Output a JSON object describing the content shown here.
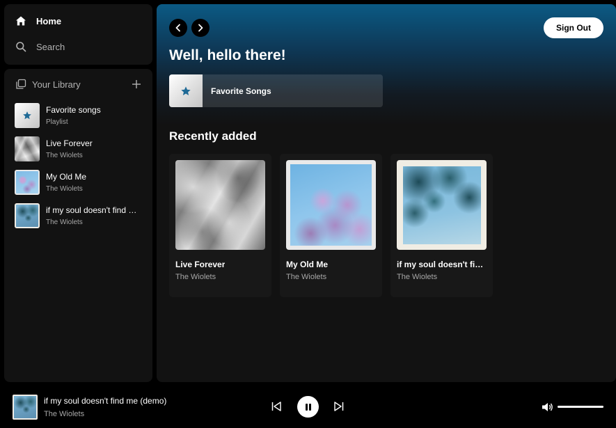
{
  "nav": {
    "home_label": "Home",
    "search_label": "Search"
  },
  "library": {
    "title": "Your Library",
    "items": [
      {
        "title": "Favorite songs",
        "subtitle": "Playlist",
        "thumb": "star-icon"
      },
      {
        "title": "Live Forever",
        "subtitle": "The Wiolets",
        "thumb": "silk-cover"
      },
      {
        "title": "My Old Me",
        "subtitle": "The Wiolets",
        "thumb": "blossom-tree-cover"
      },
      {
        "title": "if my soul doesn't find me (demo)",
        "subtitle": "The Wiolets",
        "thumb": "tree-canopy-cover"
      }
    ]
  },
  "main": {
    "greeting": "Well, hello there!",
    "sign_out_label": "Sign Out",
    "favorite_card_label": "Favorite Songs",
    "recent_heading": "Recently added",
    "recent": [
      {
        "title": "Live Forever",
        "artist": "The Wiolets",
        "art": "silk-cover"
      },
      {
        "title": "My Old Me",
        "artist": "The Wiolets",
        "art": "blossom-tree-cover"
      },
      {
        "title": "if my soul doesn't find me (demo)",
        "artist": "The Wiolets",
        "art": "tree-canopy-cover"
      }
    ]
  },
  "player": {
    "title": "if my soul doesn't find me (demo)",
    "artist": "The Wiolets",
    "is_playing": true,
    "volume": 1.0
  },
  "colors": {
    "accent_blue": "#1f6a96",
    "background": "#121212",
    "header_gradient_top": "#0b5a84"
  }
}
